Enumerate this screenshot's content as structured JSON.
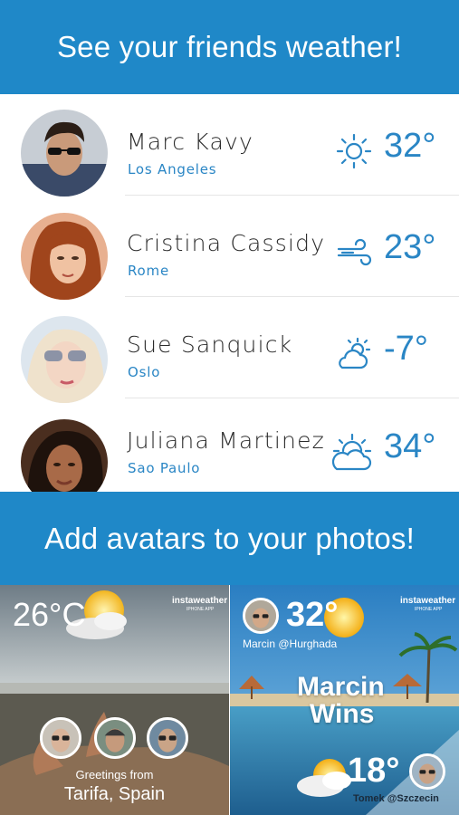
{
  "header": {
    "title": "See your friends weather!"
  },
  "friends": [
    {
      "name": "Marc Kavy",
      "city": "Los Angeles",
      "temp": "32°",
      "weather_icon": "sun-icon"
    },
    {
      "name": "Cristina Cassidy",
      "city": "Rome",
      "temp": "23°",
      "weather_icon": "wind-icon"
    },
    {
      "name": "Sue Sanquick",
      "city": "Oslo",
      "temp": "-7°",
      "weather_icon": "partly-cloudy-icon"
    },
    {
      "name": "Juliana Martinez",
      "city": "Sao Paulo",
      "temp": "34°",
      "weather_icon": "sun-cloud-icon"
    }
  ],
  "promo": {
    "title": "Add avatars to your photos!"
  },
  "photo_left": {
    "temp": "26°C",
    "brand": "instaweather",
    "brand_sub": "IPHONE APP",
    "greeting": "Greetings from",
    "location": "Tarifa, Spain"
  },
  "photo_right": {
    "temp": "32°",
    "user": "Marcin @Hurghada",
    "headline_1": "Marcin",
    "headline_2": "Wins",
    "temp2": "18°",
    "user2": "Tomek @Szczecin",
    "brand": "instaweather",
    "brand_sub": "IPHONE APP"
  },
  "colors": {
    "accent": "#1f88c8",
    "link": "#2a86c5",
    "text": "#2a2a2a"
  }
}
